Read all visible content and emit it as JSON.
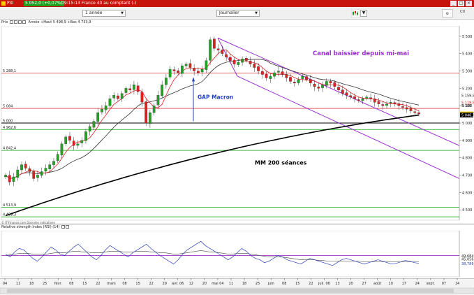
{
  "window": {
    "product": "PXI",
    "last_value": "5 052,0 (+0,07%)",
    "title": "09:15:13 France 40 au comptant (-)",
    "buttons": [
      "_",
      "□",
      "×"
    ]
  },
  "toolbar": {
    "period": "1 année",
    "interval": "Journalier",
    "corner_icon_label": "Ctl"
  },
  "infobar": {
    "instrument": "Prix",
    "stats": "Année +Haut 5 498,9 +Bas 4 733,9"
  },
  "credit": "© IT-Finance.com Données indicatives",
  "rsi": {
    "title": "Relative strength index (RSI) (14)"
  },
  "annotations": {
    "channel": "Canal baissier depuis mi-mai",
    "gap": "GAP Macron",
    "ma200": "MM 200 séances"
  },
  "colors": {
    "candle_up": "#22a322",
    "candle_down": "#e02020",
    "channel": "#9b30d0",
    "support": "#11aa11",
    "resistance": "#e03030",
    "ma_fast": "#e02020",
    "ma_mid": "#333333",
    "ma200": "#000000",
    "gap_arrow": "#2040c0",
    "last_price_bg": "#ffd200",
    "red_tag": "#e02020",
    "black_tag": "#000000"
  },
  "chart_data": [
    {
      "type": "line",
      "title": "France 40 au comptant",
      "ylim": [
        4440,
        5560
      ],
      "y_ticks": [
        5500,
        5400,
        5300,
        5200,
        5100,
        5000,
        4900,
        4800,
        4700,
        4600,
        4500
      ],
      "y_tick_labels": [
        "5 500",
        "5 400",
        "5 300",
        "5 200",
        "5 100",
        "5 000",
        "4 900",
        "4 800",
        "4 700",
        "4 600",
        "4 500"
      ],
      "x_ticks": [
        "04",
        "11",
        "18",
        "25",
        "févr.",
        "08",
        "15",
        "22",
        "mars",
        "08",
        "15",
        "22",
        "29",
        "avr. 06",
        "12",
        "20",
        "mai 04",
        "11",
        "18",
        "25",
        "juin",
        "08",
        "15",
        "22",
        "juil. 06",
        "13",
        "20",
        "27",
        "août",
        "10",
        "17",
        "24",
        "sept.",
        "07",
        "14"
      ],
      "horizontal_levels": [
        {
          "value": 5288.1,
          "label": "5 288,1",
          "kind": "resistance"
        },
        {
          "value": 5084,
          "label": "5 084",
          "kind": "resistance"
        },
        {
          "value": 5000,
          "label": "5 000",
          "kind": "key"
        },
        {
          "value": 4962.6,
          "label": "4 962,6",
          "kind": "support"
        },
        {
          "value": 4842.4,
          "label": "4 842,4",
          "kind": "support"
        },
        {
          "value": 4513.9,
          "label": "4 513,9",
          "kind": "support"
        },
        {
          "value": 4459.3,
          "label": "4 459,3",
          "kind": "support"
        }
      ],
      "right_tags": [
        {
          "value": 5159.9,
          "label": "5 159,9",
          "color": "none"
        },
        {
          "value": 5118.5,
          "label": "5 118,5",
          "color": "red"
        },
        {
          "value": 5100,
          "label": "5 100",
          "color": "none"
        },
        {
          "value": 5052.0,
          "label": "5 052,0",
          "color": "yellow"
        },
        {
          "value": 5046.3,
          "label": "5 046,3",
          "color": "black"
        }
      ],
      "series_close": [
        4700,
        4660,
        4690,
        4730,
        4760,
        4740,
        4720,
        4680,
        4700,
        4720,
        4740,
        4760,
        4780,
        4820,
        4880,
        4920,
        4900,
        4870,
        4880,
        4900,
        4950,
        4980,
        5010,
        5060,
        5080,
        5100,
        5140,
        5160,
        5140,
        5170,
        5200,
        5190,
        5220,
        5180,
        5120,
        5000,
        5060,
        5100,
        5160,
        5220,
        5260,
        5310,
        5300,
        5290,
        5330,
        5340,
        5320,
        5300,
        5290,
        5310,
        5360,
        5480,
        5430,
        5420,
        5400,
        5380,
        5360,
        5340,
        5350,
        5370,
        5360,
        5340,
        5320,
        5300,
        5280,
        5260,
        5270,
        5290,
        5300,
        5280,
        5260,
        5240,
        5230,
        5250,
        5270,
        5250,
        5230,
        5210,
        5200,
        5220,
        5240,
        5230,
        5210,
        5190,
        5170,
        5160,
        5150,
        5140,
        5130,
        5140,
        5150,
        5140,
        5120,
        5110,
        5100,
        5110,
        5120,
        5110,
        5100,
        5090,
        5080,
        5070,
        5060,
        5052
      ],
      "mm200": {
        "start": 4466,
        "end": 5046
      },
      "mm_mid_end": 5160,
      "mm_fast_end": 5118,
      "channel_upper": {
        "start": 5490,
        "end": 4870
      },
      "channel_lower": {
        "start": 5270,
        "end": 4680
      }
    },
    {
      "type": "line",
      "title": "Relative strength index (RSI) (14)",
      "ylim": [
        20,
        85
      ],
      "y_tick_labels": [
        "49,684",
        "45,056",
        "38,786"
      ],
      "right_tags": [
        {
          "value": 49.684,
          "label": "49,684",
          "color": "none"
        },
        {
          "value": 45.056,
          "label": "45,056",
          "color": "none"
        },
        {
          "value": 38.786,
          "label": "38,786",
          "color": "none"
        }
      ],
      "level": 50,
      "rsi_values": [
        52,
        48,
        55,
        60,
        58,
        52,
        46,
        42,
        48,
        55,
        62,
        58,
        52,
        50,
        56,
        62,
        66,
        60,
        54,
        48,
        44,
        50,
        58,
        64,
        60,
        56,
        52,
        48,
        54,
        58,
        62,
        66,
        60,
        55,
        50,
        46,
        42,
        38,
        44,
        52,
        58,
        62,
        66,
        70,
        64,
        60,
        56,
        52,
        48,
        44,
        48,
        54,
        60,
        56,
        50,
        46,
        44,
        40,
        42,
        46,
        50,
        48,
        44,
        42,
        40,
        38,
        42,
        46,
        44,
        42,
        40,
        38,
        36,
        40,
        44,
        46,
        44,
        42,
        40,
        38,
        40,
        42,
        44,
        42,
        40,
        38,
        39,
        41,
        43,
        42,
        40,
        39
      ],
      "signal_values": [
        50,
        51,
        52,
        53,
        53,
        53,
        52,
        52,
        52,
        52,
        53,
        54,
        54,
        54,
        55,
        56,
        56,
        55,
        55,
        54,
        54,
        54,
        55,
        56,
        56,
        56,
        55,
        55,
        55,
        56,
        56,
        56,
        55,
        55,
        54,
        54,
        53,
        52,
        52,
        53,
        54,
        55,
        56,
        57,
        56,
        55,
        55,
        54,
        53,
        52,
        52,
        53,
        53,
        53,
        52,
        51,
        50,
        49,
        48,
        48,
        48,
        48,
        47,
        46,
        45,
        44,
        44,
        44,
        44,
        43,
        43,
        42,
        42,
        42,
        42,
        42,
        42,
        42,
        42,
        41,
        41,
        41,
        41,
        41,
        41,
        41,
        41,
        41,
        41,
        41,
        41,
        41
      ]
    }
  ]
}
